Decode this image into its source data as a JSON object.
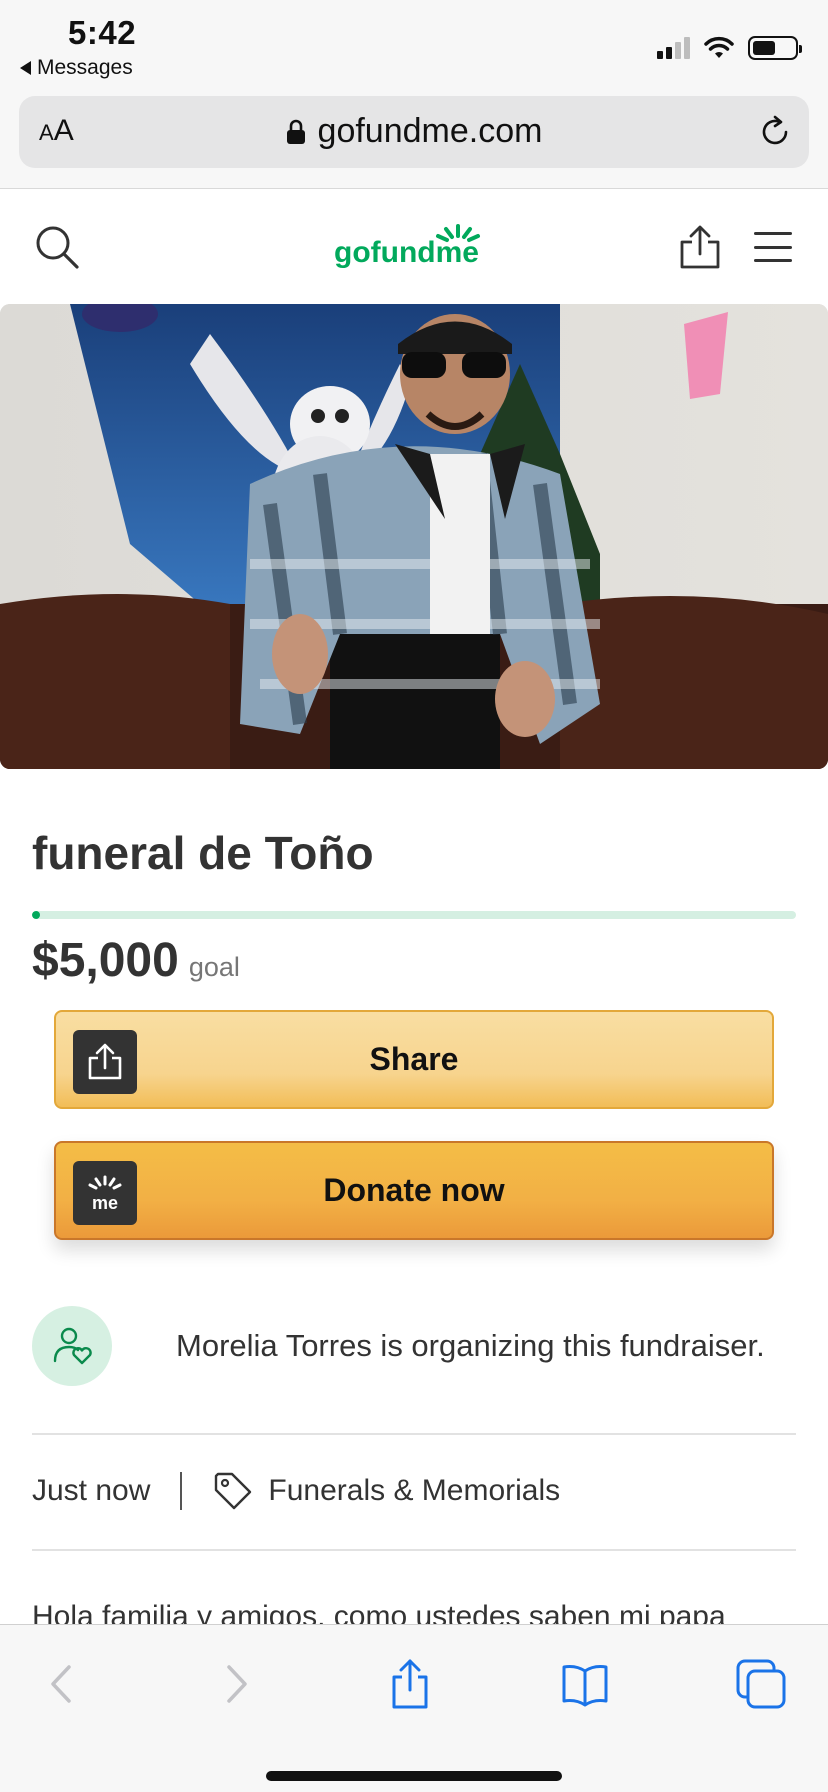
{
  "status_bar": {
    "time": "5:42",
    "back_app": "Messages"
  },
  "browser": {
    "text_size_label_small": "A",
    "text_size_label_large": "A",
    "url": "gofundme.com"
  },
  "site": {
    "logo_text": "gofundme"
  },
  "campaign": {
    "title": "funeral de Toño",
    "goal_amount": "$5,000",
    "goal_label": "goal",
    "progress_fraction": 0.01,
    "share_label": "Share",
    "donate_label": "Donate now",
    "donate_icon_text": "me",
    "organizer_text": "Morelia Torres is organizing this fundraiser.",
    "created": "Just now",
    "category": "Funerals & Memorials",
    "story_preview": "Hola familia y amigos, como ustedes saben mi papa"
  },
  "colors": {
    "brand_green": "#02a95c",
    "progress_track": "#d5efe2",
    "share_button": "#f7d48e",
    "donate_button": "#f2b045",
    "ios_blue": "#1a73e8"
  }
}
